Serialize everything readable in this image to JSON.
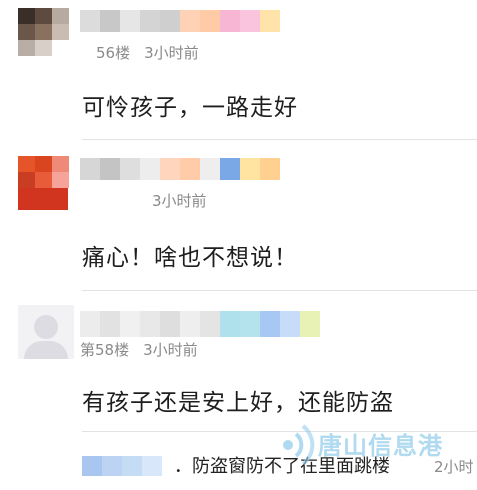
{
  "comments": [
    {
      "floor": "56楼",
      "time": "3小时前",
      "content": "可怜孩子，一路走好"
    },
    {
      "floor": "",
      "time": "3小时前",
      "content": "痛心！啥也不想说！"
    },
    {
      "floor": "第58楼",
      "time": "3小时前",
      "content": "有孩子还是安上好，还能防盗"
    }
  ],
  "reply": {
    "text": "．防盗窗防不了在里面跳楼",
    "time": "2小时"
  },
  "watermark": {
    "text": "唐山信息港"
  },
  "colors": {
    "meta_text": "#8a8a8a",
    "divider": "#e3e3e3",
    "watermark": "#96cdeb"
  }
}
